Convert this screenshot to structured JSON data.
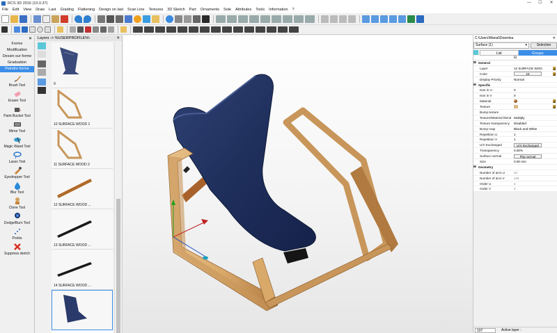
{
  "window": {
    "title": "RCS 3D 2016 (10.0.37)",
    "controls": [
      "—",
      "☐",
      "✕"
    ]
  },
  "menu": [
    "File",
    "Edit",
    "View",
    "Draw",
    "Last",
    "Grading",
    "Flattening",
    "Design on last",
    "Scan Line",
    "Textures",
    "3D Sketch",
    "Part",
    "Ornaments",
    "Sole",
    "Attributes",
    "Tools",
    "Information",
    "?"
  ],
  "left_panel": {
    "close": "✕",
    "modes": [
      "Forme",
      "Modification",
      "Dessin sur forme",
      "Graduation",
      "Peindre forme"
    ],
    "active_mode": "Peindre forme",
    "tools": [
      {
        "icon": "brush-icon",
        "label": "Brush Tool"
      },
      {
        "icon": "eraser-icon",
        "label": "Eraser Tool"
      },
      {
        "icon": "paint-bucket-icon",
        "label": "Paint Bucket Tool"
      },
      {
        "icon": "mirror-icon",
        "label": "Mirror Tool"
      },
      {
        "icon": "magic-wand-icon",
        "label": "Magic Wand Tool"
      },
      {
        "icon": "lasso-icon",
        "label": "Lasso Tool"
      },
      {
        "icon": "eyedropper-icon",
        "label": "Eyedropper Tool"
      },
      {
        "icon": "blur-icon",
        "label": "Blur Tool"
      },
      {
        "icon": "clone-icon",
        "label": "Clone Tool"
      },
      {
        "icon": "dodge-burn-icon",
        "label": "Dodge/Burn Tool"
      },
      {
        "icon": "points-icon",
        "label": "Points"
      },
      {
        "icon": "suppress-icon",
        "label": "Suppress sketch"
      }
    ]
  },
  "layers_panel": {
    "title": "Layers -> %USERPROFILE%\\",
    "close": "✕",
    "items": [
      {
        "label": "9"
      },
      {
        "label": "10   SURFACE WOOD 1"
      },
      {
        "label": "11   SURFACE WOOD 2"
      },
      {
        "label": "12   SURFACE WOOD ..."
      },
      {
        "label": "13   SURFACE WOOD ..."
      },
      {
        "label": "14   SURFACE WOOD ..."
      },
      {
        "label": ""
      }
    ]
  },
  "props_panel": {
    "path": "C:\\Users\\Manal\\Downloa",
    "close": "✕",
    "selection_value": "Surface (1)",
    "selection_button": "Selection",
    "tabs": [
      "List",
      "Groups"
    ],
    "active_tab": "Groups",
    "sort_icon": "⊟",
    "rows": [
      {
        "cat": true,
        "k": "General"
      },
      {
        "k": "Layer",
        "v": "12   SURFACE WOO",
        "pen": true
      },
      {
        "k": "Color",
        "box": "15",
        "pen": true
      },
      {
        "k": "Display Priority",
        "v": "Normal"
      },
      {
        "cat": true,
        "k": "Specific"
      },
      {
        "k": "Isos in U",
        "v": "0"
      },
      {
        "k": "Isos in V",
        "v": "0"
      },
      {
        "k": "Material",
        "ball": true,
        "pen": true
      },
      {
        "k": "Texture",
        "tex": true,
        "pen": true
      },
      {
        "k": "Bump texture",
        "v": ""
      },
      {
        "k": "Texture/Material blend",
        "v": "Multiply"
      },
      {
        "k": "Texture transparency",
        "v": "Disabled"
      },
      {
        "k": "Bump map",
        "v": "Black and White"
      },
      {
        "k": "Repetition U",
        "v": "1"
      },
      {
        "k": "Repetition V",
        "v": "1"
      },
      {
        "k": "U/V Exchanged",
        "box": "U/V Exchanged"
      },
      {
        "k": "Transparency",
        "v": "0.00%"
      },
      {
        "k": "Surface normal",
        "box": "Flip normal"
      },
      {
        "k": "Size",
        "v": "0.00 mm"
      },
      {
        "cat": true,
        "k": "Geometry"
      },
      {
        "k": "Number of arcs U",
        "v": "34",
        "grey": true
      },
      {
        "k": "Number of arcs V",
        "v": "116",
        "grey": true
      },
      {
        "k": "Order U",
        "v": "4",
        "grey": true
      },
      {
        "k": "Order V",
        "v": "4",
        "grey": true
      }
    ],
    "footer_count": "107",
    "footer_label": "Active layer :"
  },
  "colors": {
    "accent": "#3b8ee8",
    "seat": "#1f2f5c",
    "wood": "#d9a96a",
    "wood_dark": "#8a5a2a"
  }
}
